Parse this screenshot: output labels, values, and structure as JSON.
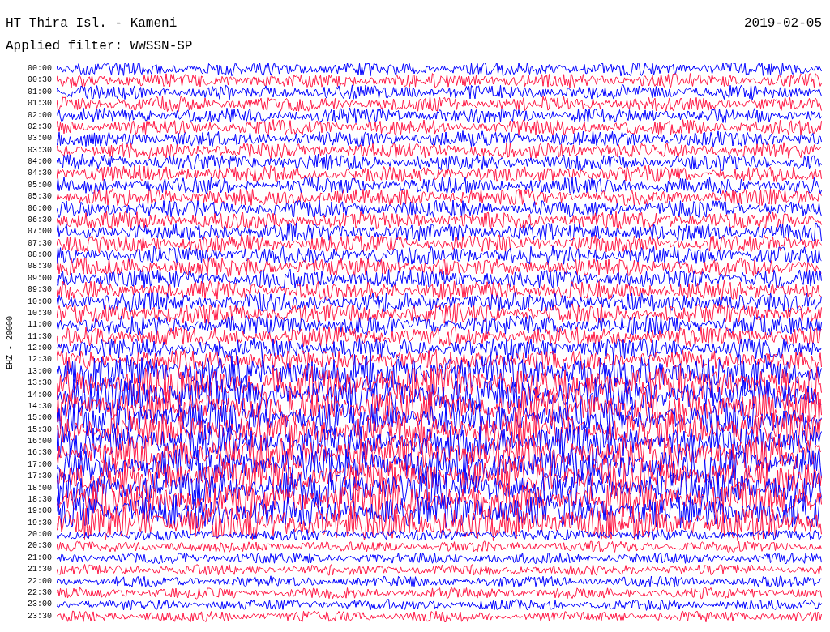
{
  "title": "HT Thira Isl. - Kameni",
  "date": "2019-02-05",
  "filter": "Applied filter: WWSSN-SP",
  "channel_label": "EHZ - 20000",
  "time_labels": [
    "00:00",
    "00:30",
    "01:00",
    "01:30",
    "02:00",
    "02:30",
    "03:00",
    "03:30",
    "04:00",
    "04:30",
    "05:00",
    "05:30",
    "06:00",
    "06:30",
    "07:00",
    "07:30",
    "08:00",
    "08:30",
    "09:00",
    "09:30",
    "10:00",
    "10:30",
    "11:00",
    "11:30",
    "12:00",
    "12:30",
    "13:00",
    "13:30",
    "14:00",
    "14:30",
    "15:00",
    "15:30",
    "16:00",
    "16:30",
    "17:00",
    "17:30",
    "18:00",
    "18:30",
    "19:00",
    "19:30",
    "20:00",
    "20:30",
    "21:00",
    "21:30",
    "22:00",
    "22:30",
    "23:00",
    "23:30"
  ]
}
